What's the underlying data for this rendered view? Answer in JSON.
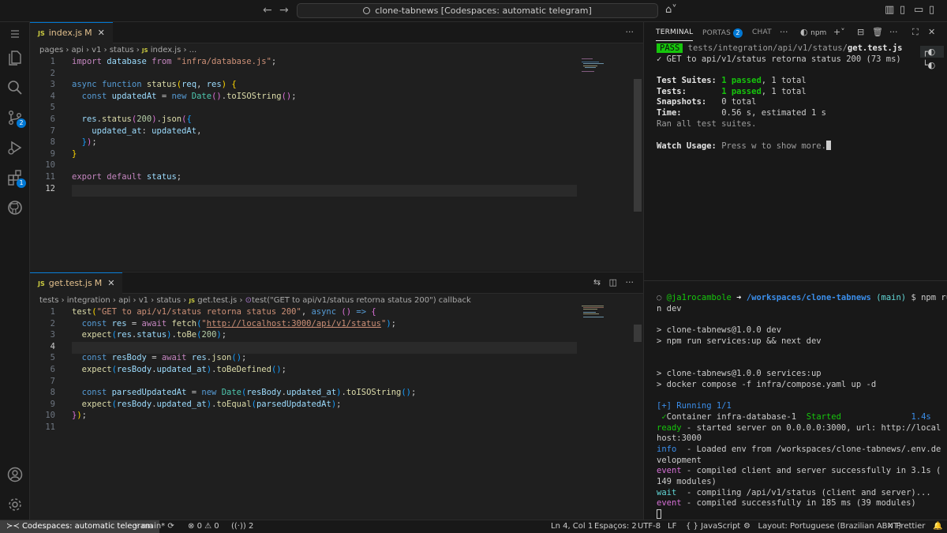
{
  "titlebar": {
    "search_text": "clone-tabnews [Codespaces: automatic telegram]"
  },
  "editor_top": {
    "tab": {
      "icon": "JS",
      "name": "index.js",
      "modified": "M"
    },
    "breadcrumb": [
      "pages",
      "api",
      "v1",
      "status",
      "index.js",
      "..."
    ],
    "lines": [
      {
        "n": "1"
      },
      {
        "n": "2"
      },
      {
        "n": "3"
      },
      {
        "n": "4"
      },
      {
        "n": "5"
      },
      {
        "n": "6"
      },
      {
        "n": "7"
      },
      {
        "n": "8"
      },
      {
        "n": "9"
      },
      {
        "n": "10"
      },
      {
        "n": "11"
      },
      {
        "n": "12"
      }
    ]
  },
  "editor_bottom": {
    "tab": {
      "icon": "JS",
      "name": "get.test.js",
      "modified": "M"
    },
    "breadcrumb": [
      "tests",
      "integration",
      "api",
      "v1",
      "status",
      "get.test.js",
      "test(\"GET to api/v1/status retorna status 200\") callback"
    ],
    "lines": [
      {
        "n": "1"
      },
      {
        "n": "2"
      },
      {
        "n": "3"
      },
      {
        "n": "4"
      },
      {
        "n": "5"
      },
      {
        "n": "6"
      },
      {
        "n": "7"
      },
      {
        "n": "8"
      },
      {
        "n": "9"
      },
      {
        "n": "10"
      },
      {
        "n": "11"
      }
    ]
  },
  "panel": {
    "tabs": {
      "terminal": "TERMINAL",
      "ports": "PORTAS",
      "ports_badge": "2",
      "chat": "CHAT",
      "npm": "npm"
    }
  },
  "terminal_top": {
    "pass_badge": "PASS",
    "test_dir": "tests/integration/api/v1/status/",
    "test_file": "get.test.js",
    "check_line": "✓ GET to api/v1/status retorna status 200 (73 ms)",
    "suites_label": "Test Suites:",
    "suites_passed": "1 passed",
    "suites_total": ", 1 total",
    "tests_label": "Tests:",
    "tests_passed": "1 passed",
    "tests_total": ", 1 total",
    "snap_label": "Snapshots:",
    "snap_value": "0 total",
    "time_label": "Time:",
    "time_value": "0.56 s, estimated 1 s",
    "ran_all": "Ran all test suites.",
    "watch_label": "Watch Usage:",
    "watch_text": "Press w to show more."
  },
  "terminal_bottom": {
    "prompt_user": "@ja1rocambole",
    "prompt_arrow": "➜",
    "prompt_path": "/workspaces/clone-tabnews",
    "prompt_branch": "(main)",
    "prompt_cmd_1": "$ npm ru",
    "prompt_cmd_2": "n dev",
    "l1": "> clone-tabnews@1.0.0 dev",
    "l2": "> npm run services:up && next dev",
    "l3": "> clone-tabnews@1.0.0 services:up",
    "l4": "> docker compose -f infra/compose.yaml up -d",
    "running": "[+] Running 1/1",
    "container_check": "✓",
    "container": "Container infra-database-1",
    "started": "Started",
    "started_time": "1.4s",
    "ready_tag": "ready",
    "ready_text_1": " - started server on 0.0.0.0:3000, url: http://local",
    "ready_text_2": "host:3000",
    "info_tag": "info",
    "info_text_1": "  - Loaded env from /workspaces/clone-tabnews/.env.de",
    "info_text_2": "velopment",
    "event_tag": "event",
    "event_text_1": " - compiled client and server successfully in 3.1s (",
    "event_text_2": "149 modules)",
    "wait_tag": "wait",
    "wait_text": "  - compiling /api/v1/status (client and server)...",
    "event2_tag": "event",
    "event2_text": " - compiled successfully in 185 ms (39 modules)"
  },
  "statusbar": {
    "remote": "Codespaces: automatic telegram",
    "branch": "main*",
    "errors": "0",
    "warnings": "0",
    "ports": "2",
    "position": "Ln 4, Col 1",
    "spaces": "Espaços: 2",
    "encoding": "UTF-8",
    "eol": "LF",
    "language_braces": "{ }",
    "language": "JavaScript",
    "layout": "Layout: Portuguese (Brazilian ABNT)",
    "prettier": "Prettier"
  },
  "colors": {
    "accent": "#0078d4",
    "pass_green": "#16c60c",
    "editor_bg": "#1f1f1f"
  }
}
